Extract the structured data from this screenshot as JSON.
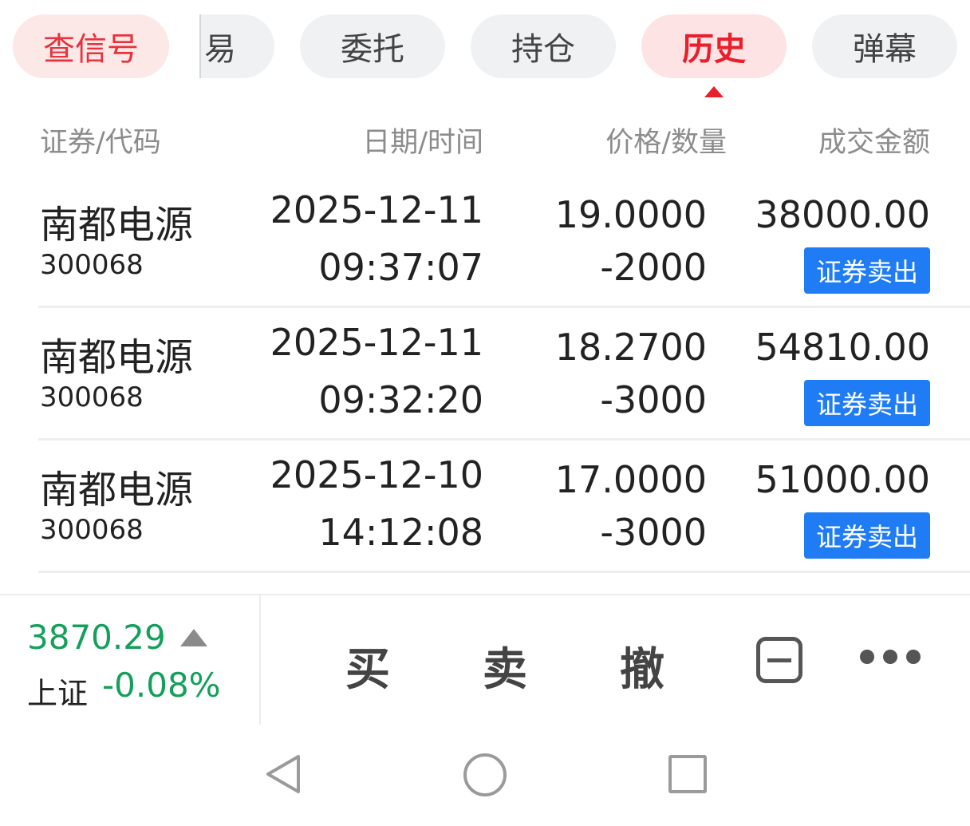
{
  "tabs": {
    "check_signal": "查信号",
    "trade_clipped": "易",
    "orders": "委托",
    "positions": "持仓",
    "history": "历史",
    "danmaku": "弹幕"
  },
  "table": {
    "headers": {
      "security": "证券/代码",
      "datetime": "日期/时间",
      "price_qty": "价格/数量",
      "amount": "成交金额"
    },
    "rows": [
      {
        "name": "南都电源",
        "code": "300068",
        "date": "2025-12-11",
        "time": "09:37:07",
        "price": "19.0000",
        "qty": "-2000",
        "amount": "38000.00",
        "type": "证券卖出"
      },
      {
        "name": "南都电源",
        "code": "300068",
        "date": "2025-12-11",
        "time": "09:32:20",
        "price": "18.2700",
        "qty": "-3000",
        "amount": "54810.00",
        "type": "证券卖出"
      },
      {
        "name": "南都电源",
        "code": "300068",
        "date": "2025-12-10",
        "time": "14:12:08",
        "price": "17.0000",
        "qty": "-3000",
        "amount": "51000.00",
        "type": "证券卖出"
      }
    ]
  },
  "bottom": {
    "index_value": "3870.29",
    "index_name": "上证",
    "index_change": "-0.08%",
    "buy": "买",
    "sell": "卖",
    "cancel": "撤"
  },
  "colors": {
    "accent_red": "#e8202c",
    "badge_blue": "#1f7cf5",
    "index_green": "#14a05a"
  },
  "icons": [
    "triangle-up-icon",
    "minus-square-icon",
    "more-dots-icon",
    "nav-back-icon",
    "nav-home-icon",
    "nav-recent-icon"
  ]
}
